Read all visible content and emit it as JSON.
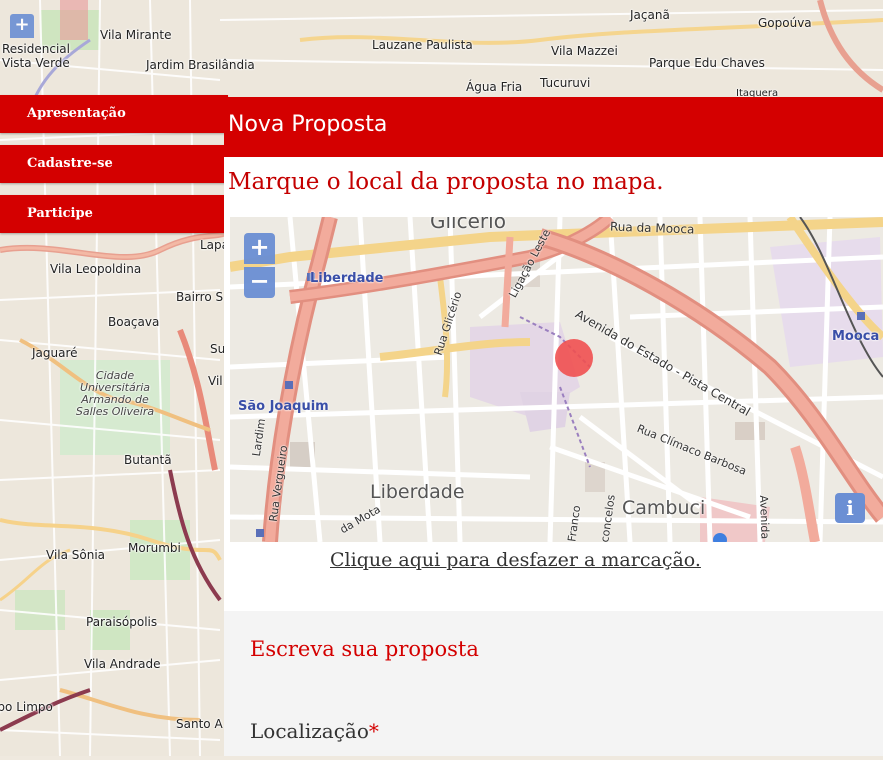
{
  "background_map": {
    "zoom_in": "+",
    "labels": [
      "Vila Mirante",
      "Jaçanã",
      "Gopoúva",
      "Lauzane Paulista",
      "Vila Mazzei",
      "Residencial",
      "Vista Verde",
      "Jardim Brasilândia",
      "Parque Edu Chaves",
      "Água Fria",
      "Tucuruvi",
      "Itaquera",
      "Lapa",
      "Vila Leopoldina",
      "Bairro S",
      "Boaçava",
      "Jaguaré",
      "Su",
      "Vil",
      "Cidade Universitária Armando de Salles Oliveira",
      "Butantã",
      "Vila Sônia",
      "Morumbi",
      "Paraisópolis",
      "Vila Andrade",
      "Santo A",
      "Campo Limpo"
    ]
  },
  "nav": {
    "items": [
      {
        "label": "Apresentação"
      },
      {
        "label": "Cadastre-se"
      },
      {
        "label": "Participe"
      }
    ]
  },
  "panel": {
    "title": "Nova Proposta",
    "instruction": "Marque o local da proposta no mapa.",
    "map": {
      "zoom_in": "+",
      "zoom_out": "−",
      "info": "i",
      "labels": {
        "glicerio": "Glicério",
        "rua_da_mooca": "Rua da Mooca",
        "liberdade_station": "Liberdade",
        "ligacao_leste": "Ligação Leste",
        "avenida_do_estado": "Avenida do Estado - Pista Central",
        "rua_glicerio": "Rua Glicério",
        "mooca": "Mooca",
        "sao_joaquim": "São Joaquim",
        "rua_vergueiro": "Rua Vergueiro",
        "rua_climaco_barbosa": "Rua Clímaco Barbosa",
        "liberdade_district": "Liberdade",
        "cambuci": "Cambuci",
        "avenida_d": "Avenida D",
        "rua_da_mota": "da Mota",
        "franco": "Franco",
        "concelos": "concelos",
        "lardim": "Lardim"
      }
    },
    "undo_link": "Clique aqui para desfazer a marcação.",
    "section_title": "Escreva sua proposta",
    "location_label": "Localização",
    "required_mark": "*"
  },
  "colors": {
    "brand_red": "#d40000",
    "zoom_blue": "#6b8fd4",
    "marker": "#f05050"
  }
}
